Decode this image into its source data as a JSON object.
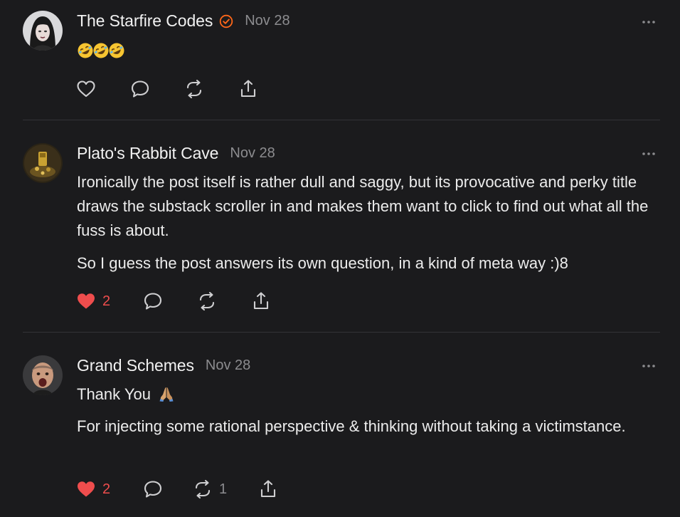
{
  "colors": {
    "background": "#1b1b1d",
    "text": "#ececec",
    "muted": "#8c8c8f",
    "like_red": "#ef4d4d",
    "verified_orange": "#ff6719",
    "divider": "#333337"
  },
  "comments": [
    {
      "author": "The Starfire Codes",
      "verified": true,
      "date": "Nov 28",
      "avatar_icon": "avatar-woman-icon",
      "paragraphs": [],
      "emoji": [
        "rolling-laughing-emoji",
        "rolling-laughing-emoji",
        "rolling-laughing-emoji"
      ],
      "likes": "",
      "liked": false,
      "restacks": ""
    },
    {
      "author": "Plato's Rabbit Cave",
      "verified": false,
      "date": "Nov 28",
      "avatar_icon": "avatar-cave-icon",
      "paragraphs": [
        "Ironically the post itself is rather dull and saggy, but its provocative and perky title draws the substack scroller in and makes them want to click to find out what all the fuss is about.",
        "So I guess the post answers its own question, in a kind of meta way :)8"
      ],
      "likes": "2",
      "liked": true,
      "restacks": ""
    },
    {
      "author": "Grand Schemes",
      "verified": false,
      "date": "Nov 28",
      "avatar_icon": "avatar-man-icon",
      "paragraphs": [
        "Thank You",
        "For injecting some rational perspective & thinking without taking a victimstance."
      ],
      "thank_emoji": "folded-hands-emoji",
      "likes": "2",
      "liked": true,
      "restacks": "1"
    }
  ]
}
